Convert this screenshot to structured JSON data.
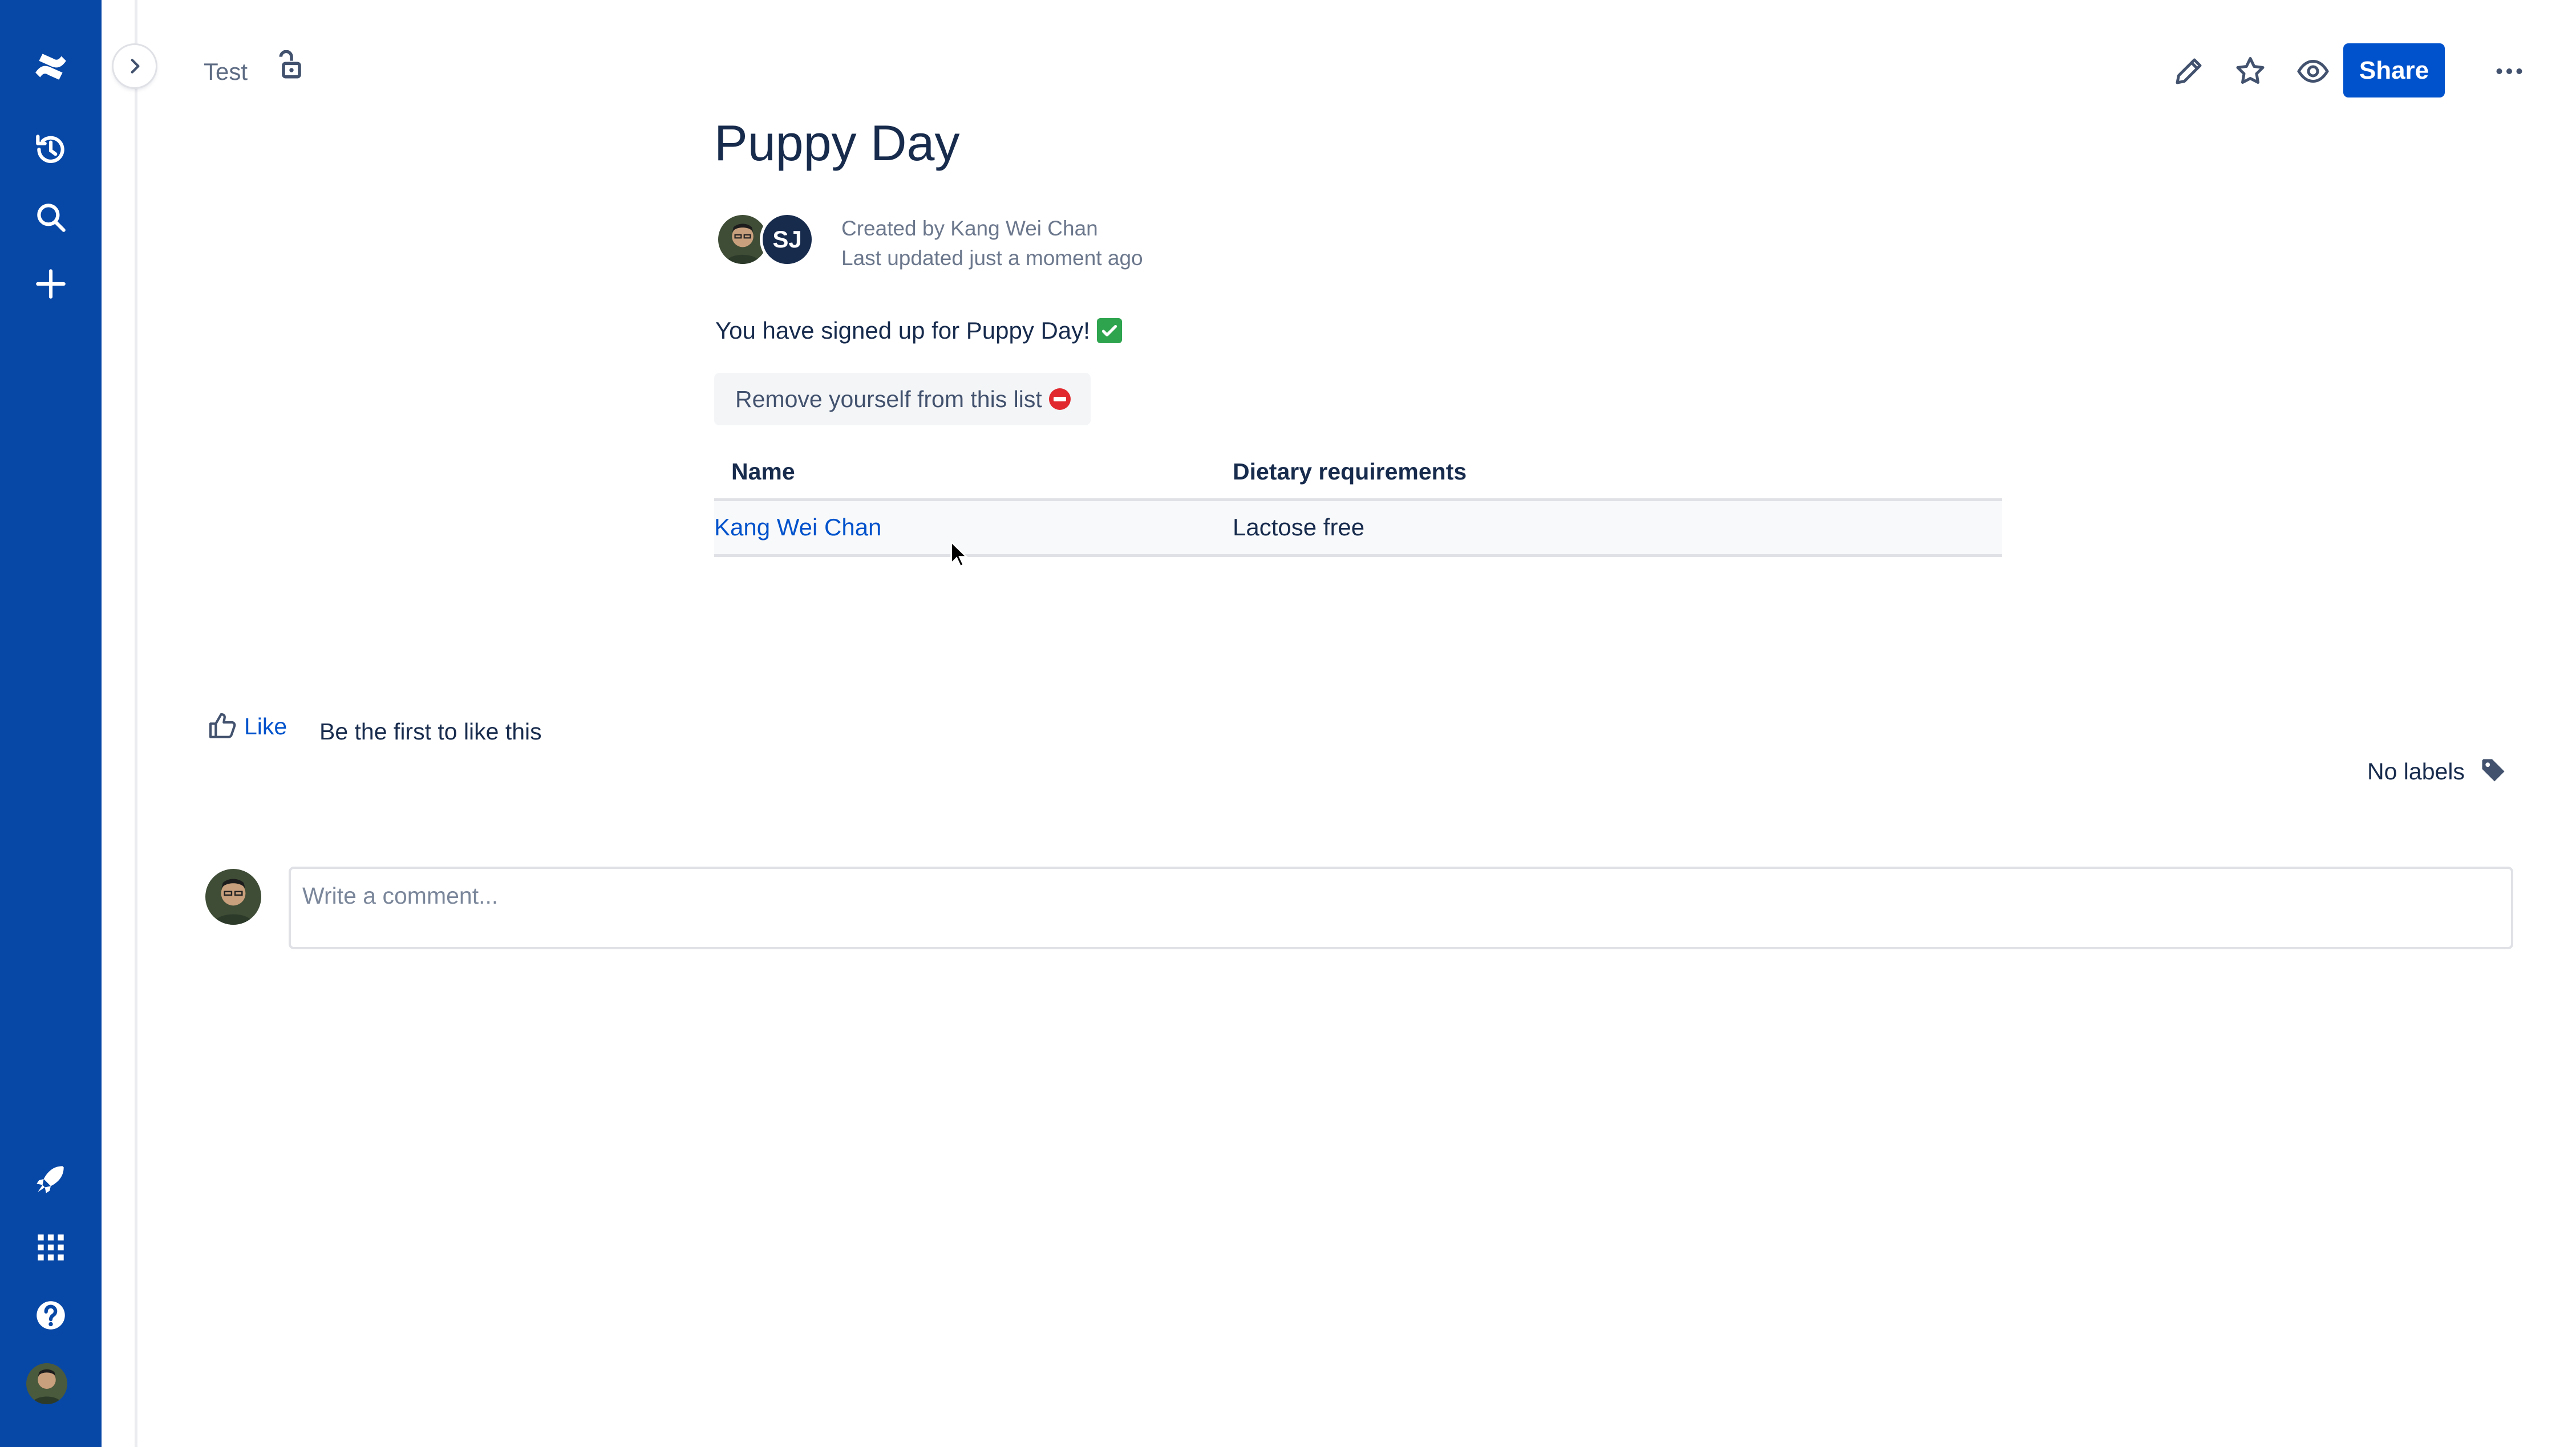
{
  "nav": {
    "items": [
      {
        "name": "confluence-logo-icon"
      },
      {
        "name": "recent-icon"
      },
      {
        "name": "search-icon"
      },
      {
        "name": "create-icon"
      },
      {
        "name": "notifications-icon"
      },
      {
        "name": "app-switcher-icon"
      },
      {
        "name": "help-icon"
      },
      {
        "name": "profile-avatar"
      }
    ]
  },
  "header": {
    "breadcrumb": "Test",
    "share_label": "Share"
  },
  "page": {
    "title": "Puppy Day",
    "avatar_initials": "SJ",
    "created_by": "Created by Kang Wei Chan",
    "last_updated": "Last updated just a moment ago",
    "signed_up_text": "You have signed up for Puppy Day!",
    "remove_label": "Remove yourself from this list"
  },
  "table": {
    "headers": [
      "Name",
      "Dietary requirements"
    ],
    "rows": [
      {
        "name": "Kang Wei Chan",
        "diet": "Lactose free"
      }
    ]
  },
  "footer": {
    "like_label": "Like",
    "like_text": "Be the first to like this",
    "labels_text": "No labels",
    "comment_placeholder": "Write a comment..."
  },
  "colors": {
    "nav_bg": "#0747a6",
    "accent": "#0052cc",
    "text": "#172b4d"
  }
}
